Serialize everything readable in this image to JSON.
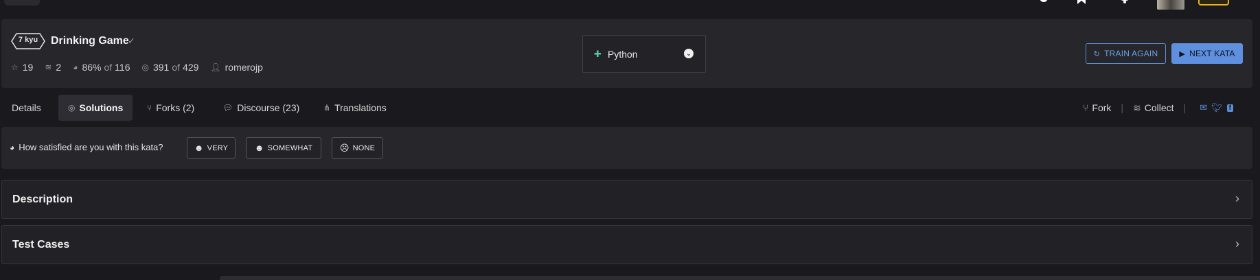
{
  "kata": {
    "rank": "7 kyu",
    "title": "Drinking Game",
    "stats": {
      "stars": "19",
      "collections": "2",
      "satisfaction": "86%",
      "satisfaction_of": "of",
      "satisfaction_total": "116",
      "completed": "391",
      "completed_of": "of",
      "completed_total": "429",
      "author": "romerojp"
    }
  },
  "language": {
    "selected": "Python"
  },
  "buttons": {
    "train_again": "TRAIN AGAIN",
    "next_kata": "NEXT KATA"
  },
  "tabs": [
    {
      "label": "Details"
    },
    {
      "label": "Solutions"
    },
    {
      "label": "Forks (2)"
    },
    {
      "label": "Discourse (23)"
    },
    {
      "label": "Translations"
    }
  ],
  "actions": {
    "fork": "Fork",
    "collect": "Collect"
  },
  "survey": {
    "question": "How satisfied are you with this kata?",
    "options": [
      "VERY",
      "SOMEWHAT",
      "NONE"
    ]
  },
  "sections": {
    "description": "Description",
    "test_cases": "Test Cases"
  },
  "colors": {
    "accent": "#5f8fdf",
    "python": "#5cc6a0",
    "background": "#1a1a1e",
    "panel": "#26262b"
  }
}
